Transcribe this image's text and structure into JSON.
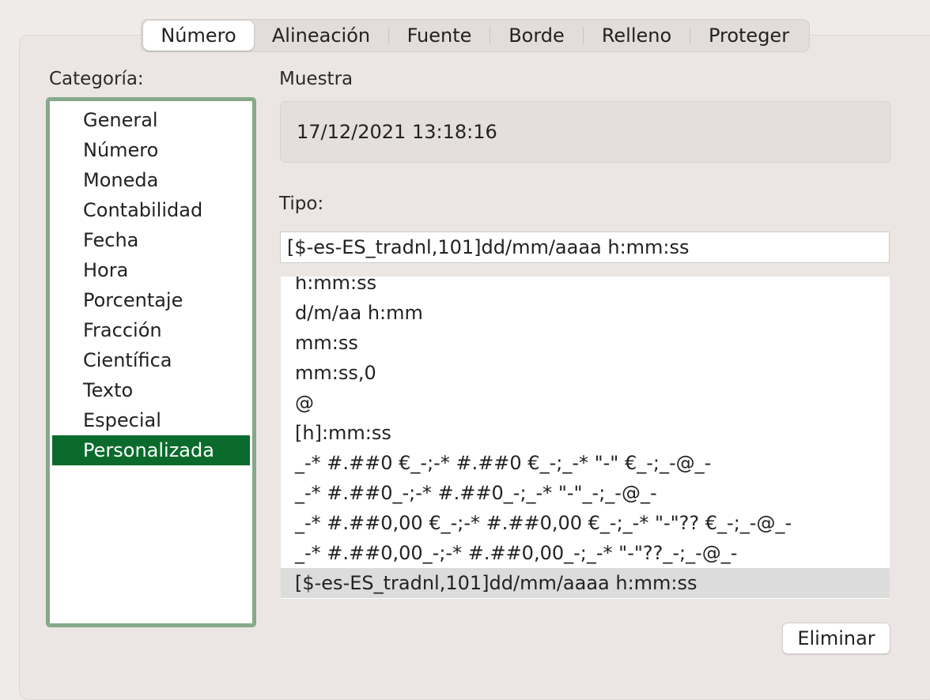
{
  "tabs": [
    {
      "label": "Número",
      "active": true
    },
    {
      "label": "Alineación",
      "active": false
    },
    {
      "label": "Fuente",
      "active": false
    },
    {
      "label": "Borde",
      "active": false
    },
    {
      "label": "Relleno",
      "active": false
    },
    {
      "label": "Proteger",
      "active": false
    }
  ],
  "category": {
    "label": "Categoría:",
    "items": [
      "General",
      "Número",
      "Moneda",
      "Contabilidad",
      "Fecha",
      "Hora",
      "Porcentaje",
      "Fracción",
      "Científica",
      "Texto",
      "Especial",
      "Personalizada"
    ],
    "selected": "Personalizada"
  },
  "sample": {
    "label": "Muestra",
    "value": "17/12/2021 13:18:16"
  },
  "type": {
    "label": "Tipo:",
    "input_value": "[$-es-ES_tradnl,101]dd/mm/aaaa h:mm:ss",
    "formats": [
      "h:mm:ss",
      "d/m/aa h:mm",
      "mm:ss",
      "mm:ss,0",
      "@",
      "[h]:mm:ss",
      "_-* #.##0 €_-;-* #.##0 €_-;_-* \"-\" €_-;_-@_-",
      "_-* #.##0_-;-* #.##0_-;_-* \"-\"_-;_-@_-",
      "_-* #.##0,00 €_-;-* #.##0,00 €_-;_-* \"-\"?? €_-;_-@_-",
      "_-* #.##0,00_-;-* #.##0,00_-;_-* \"-\"??_-;_-@_-",
      "[$-es-ES_tradnl,101]dd/mm/aaaa h:mm:ss"
    ],
    "selected_index": 10
  },
  "buttons": {
    "delete_label": "Eliminar"
  },
  "colors": {
    "selection_green": "#0b6b2c",
    "focus_ring": "#86a989",
    "list_selection_gray": "#dcdcdc"
  }
}
